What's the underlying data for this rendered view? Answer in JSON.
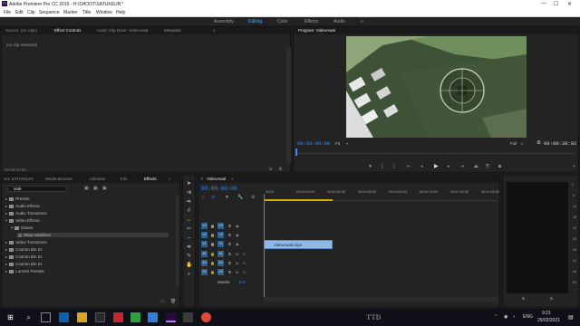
{
  "window": {
    "title": "Adobe Premiere Pro CC 2015 - H:\\SHOOT\\SATUKEUN *",
    "controls": [
      "—",
      "☐",
      "✕"
    ]
  },
  "menu": [
    "File",
    "Edit",
    "Clip",
    "Sequence",
    "Marker",
    "Title",
    "Window",
    "Help"
  ],
  "workspaces": [
    "Assembly",
    "Editing",
    "Color",
    "Effects",
    "Audio"
  ],
  "workspaces_more": "»",
  "active_workspace": "Editing",
  "source_panel": {
    "tabs": [
      "Source: (no clips)",
      "Effect Controls",
      "Audio Clip Mixer: VideoAwal",
      "Metadata"
    ],
    "menu_icon": "≡",
    "message": "(no clip selected)",
    "timecode": "00:00:00:00"
  },
  "program_panel": {
    "tab": "Program: VideoAwal",
    "timecode_left": "00:00:00:00",
    "fit": "Fit",
    "quality": "Full",
    "timecode_right": "00:00:38:02"
  },
  "project_panel": {
    "tabs": [
      "ect: SATUKEUN",
      "Media Browser",
      "Libraries",
      "Info",
      "Effects"
    ],
    "search_value": "stab",
    "tree": [
      {
        "label": "Presets",
        "expanded": false,
        "indent": 0
      },
      {
        "label": "Audio Effects",
        "expanded": false,
        "indent": 0
      },
      {
        "label": "Audio Transitions",
        "expanded": false,
        "indent": 0
      },
      {
        "label": "Video Effects",
        "expanded": true,
        "indent": 0
      },
      {
        "label": "Distort",
        "expanded": true,
        "indent": 1
      },
      {
        "label": "Warp Stabilizer",
        "expanded": false,
        "indent": 2,
        "selected": true
      },
      {
        "label": "Video Transitions",
        "expanded": false,
        "indent": 0
      },
      {
        "label": "Custom Bin 01",
        "expanded": false,
        "indent": 0
      },
      {
        "label": "Custom Bin 01",
        "expanded": false,
        "indent": 0
      },
      {
        "label": "Custom Bin 01",
        "expanded": false,
        "indent": 0
      },
      {
        "label": "Lumetri Presets",
        "expanded": false,
        "indent": 0
      }
    ]
  },
  "timeline": {
    "tab": "VideoAwal",
    "timecode": "00:00:00:00",
    "ruler": [
      "00:00",
      "00:00:15:00",
      "00:00:30:00",
      "00:00:45:00",
      "00:01:00:00",
      "00:01:15:00",
      "00:01:30:00",
      "00:01:45:00",
      "00:02:00:00"
    ],
    "tracks": [
      {
        "target": "V3",
        "name": "V3"
      },
      {
        "target": "V2",
        "name": "V2"
      },
      {
        "target": "V1",
        "name": "V1"
      },
      {
        "target": "A1",
        "name": "A1"
      },
      {
        "target": "A2",
        "name": "A2"
      },
      {
        "target": "A3",
        "name": "A3"
      }
    ],
    "master_label": "Master",
    "master_value": "0.0",
    "clip_label": "VideoAwal.mp4"
  },
  "audio_meter": {
    "ticks": [
      "0",
      "-6",
      "-12",
      "-18",
      "-24",
      "-30",
      "-36",
      "-42",
      "-48",
      "-54"
    ],
    "solo_labels": [
      "S",
      "S"
    ]
  },
  "taskbar": {
    "lang": "ENG",
    "time": "9:21",
    "date": "25/02/2021"
  },
  "watermark": "TTD",
  "colors": {
    "accent_blue": "#2f8cff",
    "clip_blue": "#8fb8e6",
    "track_target": "#2d5f8a"
  }
}
